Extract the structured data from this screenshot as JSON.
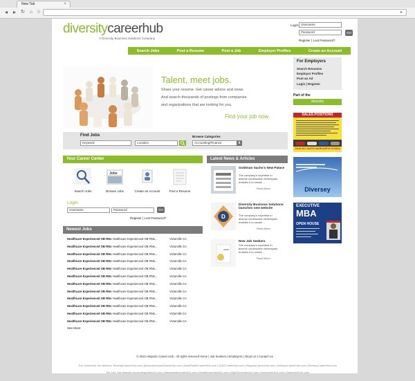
{
  "browser": {
    "tab_title": "New Tab"
  },
  "header": {
    "logo_part1": "diversity",
    "logo_part2": "careerhub",
    "tagline": "A Diversity Business Solutions Company",
    "login_label": "Login:",
    "username_value": "Username",
    "password_value": "Password",
    "go_label": "GO",
    "register": "Register",
    "sep": "|",
    "lost_password": "Lost Password?"
  },
  "nav": [
    "Search Jobs",
    "Post a Resume",
    "Post a Job",
    "Employer Profiles",
    "Create an Account"
  ],
  "hero": {
    "headline": "Talent, meet jobs.",
    "lines": [
      "Share your resume. Get career advice and news.",
      "And search thousands of postings from companies",
      "and organizations that are looking for you."
    ],
    "cta": "Find your job now."
  },
  "employers": {
    "title": "For Employers",
    "items": [
      "Search Resumes",
      "Employer Profiles",
      "Post an Ad",
      "Login | Register"
    ],
    "part_of": "Part of the",
    "network_badge": "diversity"
  },
  "find_jobs": {
    "title": "Find Jobs",
    "keyword": "Keyword",
    "location": "Location",
    "browse_label": "Browse Categories",
    "category": "Accounting/Finance"
  },
  "career_center": {
    "title": "Your Career Center",
    "items": [
      "Search Jobs",
      "Browse Jobs",
      "Create an Account",
      "Post a Resume"
    ],
    "login_title": "Login",
    "username": "Username",
    "password": "Password",
    "go": "GO",
    "register": "Register",
    "sep": "|",
    "lost": "Lost Password?"
  },
  "news": {
    "title": "Latest News & Articles",
    "items": [
      {
        "title": "Goldman Sachs's New Palace",
        "body": "The company's expertise in diverse construction techniques enables it to create ...",
        "more": "Read More"
      },
      {
        "title": "Diversity Business Solutions launches new website",
        "body": "The company's expertise in diverse construction techniques enables it to create ...",
        "more": "Read More"
      },
      {
        "title": "New Job Seekers",
        "body": "The company's expertise in diverse construction techniques enables it to create ...",
        "more": "Read More"
      }
    ]
  },
  "newest_jobs": {
    "title": "Newest Jobs",
    "rows": [
      {
        "a": "Healthcare Experienced OB RNs",
        "b": "Healthcare Experienced OB RNs...",
        "c": "Victorville CA"
      },
      {
        "a": "Healthcare Experienced OB RNs",
        "b": "Healthcare Experienced OB RNs...",
        "c": "Victorville CA"
      },
      {
        "a": "Healthcare Experienced OB RNs",
        "b": "Healthcare Experienced OB RNs...",
        "c": "Victorville CA"
      },
      {
        "a": "Healthcare Experienced OB RNs",
        "b": "Healthcare Experienced OB RNs...",
        "c": "Victorville CA"
      },
      {
        "a": "Healthcare Experienced OB RNs",
        "b": "Healthcare Experienced OB RNs...",
        "c": "Victorville CA"
      },
      {
        "a": "Healthcare Experienced OB RNs",
        "b": "Healthcare Experienced OB RNs...",
        "c": "Victorville CA"
      },
      {
        "a": "Healthcare Experienced OB RNs",
        "b": "Healthcare Experienced OB RNs...",
        "c": "Victorville CA"
      },
      {
        "a": "Healthcare Experienced OB RNs",
        "b": "Healthcare Experienced OB RNs...",
        "c": "Victorville CA"
      },
      {
        "a": "Healthcare Experienced OB RNs",
        "b": "Healthcare Experienced OB RNs...",
        "c": "Victorville CA"
      },
      {
        "a": "Healthcare Experienced OB RNs",
        "b": "Healthcare Experienced OB RNs...",
        "c": "Victorville CA"
      },
      {
        "a": "Healthcare Experienced OB RNs",
        "b": "Healthcare Experienced OB RNs...",
        "c": "Victorville CA"
      },
      {
        "a": "Healthcare Experienced OB RNs",
        "b": "Healthcare Experienced OB RNs...",
        "c": "Victorville CA"
      }
    ],
    "see_more": "See More"
  },
  "ads": {
    "ad1_title": "SALES POSITIONS",
    "ad1_footer": "RANCHO SANTA MARGARITA HONDA",
    "ad2_brand": "Diversey",
    "ad3_line1": "EXECUTIVE",
    "ad3_line2": "MBA",
    "ad3_line3": "OPEN HOUSE"
  },
  "footer": {
    "text": "© 2010  Hispanic Career Hub - All rights reserved    Home  |  Job Seekers  |  Employers  |  About Us  |  Contact Us",
    "network1": "The CareerHub Job Network:  DiversityCareerHub.com  |  AfricanAmericanCareerHub.com  |  AsianPacificCareerHub.com  |  GLBTCareerHub.com  |  HispanicCareerHub.com  |  VeteransCareerHub.com  |  WomensCareerHub.com",
    "network2": "The 1to1 Job Network:  AccountingJobs1to1.com  |  AdministrativeJobs1to1.com  |  HealthCareJobs1to1.com  |  HighTechJobs1to1.com  |  HourlyJobs1to1.com  |  SalesJobs1to1.com"
  }
}
